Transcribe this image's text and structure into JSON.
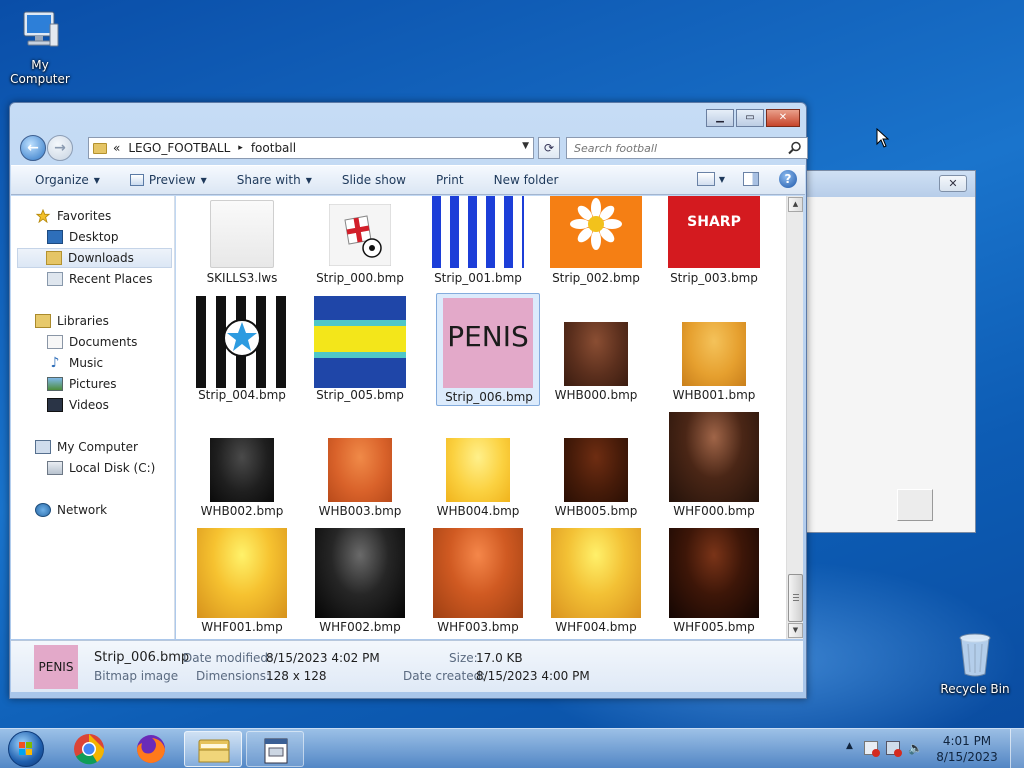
{
  "desktop": {
    "icons": [
      {
        "label": "My Computer"
      },
      {
        "label": "Recycle Bin"
      }
    ]
  },
  "explorer": {
    "breadcrumb": [
      "«",
      "LEGO_FOOTBALL",
      "▸",
      "football"
    ],
    "search_placeholder": "Search football",
    "commands": [
      "Organize",
      "Preview",
      "Share with",
      "Slide show",
      "Print",
      "New folder"
    ],
    "nav": {
      "favorites": "Favorites",
      "desktop": "Desktop",
      "downloads": "Downloads",
      "recent": "Recent Places",
      "libraries": "Libraries",
      "documents": "Documents",
      "music": "Music",
      "pictures": "Pictures",
      "videos": "Videos",
      "computer": "My Computer",
      "localdisk": "Local Disk (C:)",
      "network": "Network"
    },
    "files": [
      "SKILLS3.lws",
      "Strip_000.bmp",
      "Strip_001.bmp",
      "Strip_002.bmp",
      "Strip_003.bmp",
      "Strip_004.bmp",
      "Strip_005.bmp",
      "Strip_006.bmp",
      "WHB000.bmp",
      "WHB001.bmp",
      "WHB002.bmp",
      "WHB003.bmp",
      "WHB004.bmp",
      "WHB005.bmp",
      "WHF000.bmp",
      "WHF001.bmp",
      "WHF002.bmp",
      "WHF003.bmp",
      "WHF004.bmp",
      "WHF005.bmp"
    ],
    "thumb_text": {
      "sharp": "SHARP",
      "strip006": "PENIS"
    },
    "details": {
      "preview_text": "PENIS",
      "filename": "Strip_006.bmp",
      "type": "Bitmap image",
      "date_modified_label": "Date modified:",
      "date_modified": "8/15/2023 4:02 PM",
      "dimensions_label": "Dimensions:",
      "dimensions": "128 x 128",
      "size_label": "Size:",
      "size": "17.0 KB",
      "date_created_label": "Date created:",
      "date_created": "8/15/2023 4:00 PM"
    }
  },
  "taskbar": {
    "time": "4:01 PM",
    "date": "8/15/2023"
  }
}
